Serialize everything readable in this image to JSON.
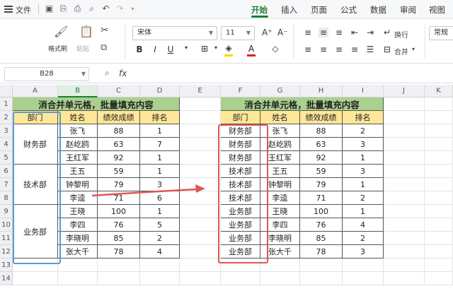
{
  "menubar": {
    "file_label": "文件",
    "tabs": [
      {
        "label": "开始",
        "active": true
      },
      {
        "label": "插入",
        "active": false
      },
      {
        "label": "页面",
        "active": false
      },
      {
        "label": "公式",
        "active": false
      },
      {
        "label": "数据",
        "active": false
      },
      {
        "label": "审阅",
        "active": false
      },
      {
        "label": "视图",
        "active": false
      }
    ],
    "accent_color": "#1e7e34"
  },
  "ribbon": {
    "format_painter": "格式刷",
    "paste": "粘贴",
    "font_name": "宋体",
    "font_size": "11",
    "wrap_text": "换行",
    "merge": "合并",
    "number_format": "常规",
    "font_color": "#e02020",
    "fill_color": "#ffd700"
  },
  "formula_bar": {
    "name_box": "B28",
    "fx_label": "fx",
    "formula": ""
  },
  "columns": [
    "A",
    "B",
    "C",
    "D",
    "E",
    "F",
    "G",
    "H",
    "I",
    "J",
    "K"
  ],
  "selected_column": "B",
  "rows": [
    "1",
    "2",
    "3",
    "4",
    "5",
    "6",
    "7",
    "8",
    "9",
    "10",
    "11",
    "12",
    "13",
    "14"
  ],
  "left_table": {
    "title": "消合并单元格，批量填充内容",
    "headers": [
      "部门",
      "姓名",
      "绩效成绩",
      "排名"
    ],
    "merged_departments": [
      "财务部",
      "技术部",
      "业务部"
    ],
    "names": [
      "张飞",
      "赵屹鸥",
      "王红军",
      "王五",
      "钟黎明",
      "李逵",
      "王晓",
      "李四",
      "李晓明",
      "张大千"
    ],
    "scores": [
      "88",
      "63",
      "92",
      "59",
      "79",
      "71",
      "100",
      "76",
      "85",
      "78"
    ],
    "ranks": [
      "1",
      "7",
      "1",
      "1",
      "3",
      "6",
      "1",
      "5",
      "2",
      "4"
    ]
  },
  "right_table": {
    "title": "消合并单元格，批量填充内容",
    "headers": [
      "部门",
      "姓名",
      "绩效成绩",
      "排名"
    ],
    "departments": [
      "财务部",
      "财务部",
      "财务部",
      "技术部",
      "技术部",
      "技术部",
      "业务部",
      "业务部",
      "业务部",
      "业务部"
    ],
    "names": [
      "张飞",
      "赵屹鸥",
      "王红军",
      "王五",
      "钟黎明",
      "李逵",
      "王晓",
      "李四",
      "李晓明",
      "张大千"
    ],
    "scores": [
      "88",
      "63",
      "92",
      "59",
      "79",
      "71",
      "100",
      "76",
      "85",
      "78"
    ],
    "ranks": [
      "2",
      "3",
      "1",
      "3",
      "1",
      "2",
      "1",
      "4",
      "2",
      "3"
    ]
  },
  "colors": {
    "title_fill": "#a9d08e",
    "header_fill": "#ffe699",
    "left_highlight": "#5b9bd5",
    "right_highlight": "#e05555",
    "arrow": "#e05555"
  }
}
